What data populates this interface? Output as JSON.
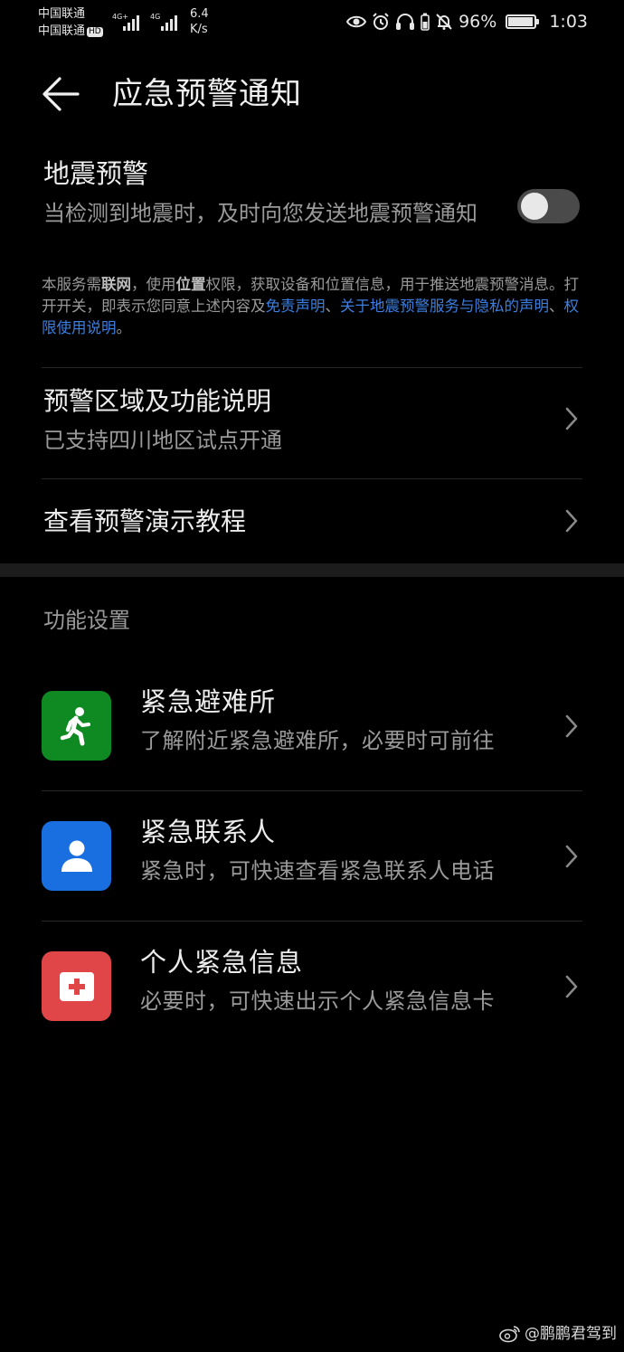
{
  "status_bar": {
    "carrier1": "中国联通",
    "carrier2": "中国联通",
    "hd_badge": "HD",
    "net1": "4G+",
    "net2": "4G",
    "speed_value": "6.4",
    "speed_unit": "K/s",
    "battery_percent": "96%",
    "battery_level": 0.96,
    "time": "1:03",
    "icons": [
      "eye-icon",
      "alarm-icon",
      "headset-icon",
      "mute-bell-icon",
      "battery-icon"
    ]
  },
  "header": {
    "back_icon": "arrow-left-icon",
    "title": "应急预警通知"
  },
  "earthquake": {
    "title": "地震预警",
    "description": "当检测到地震时，及时向您发送地震预警通知",
    "toggle_on": false,
    "notice": {
      "p1": "本服务需",
      "b1": "联网",
      "p2": "，使用",
      "b2": "位置",
      "p3": "权限，获取设备和位置信息，用于推送地震预警消息。打开开关，即表示您同意上述内容及",
      "link1": "免责声明",
      "sep1": "、",
      "link2": "关于地震预警服务与隐私的声明",
      "sep2": "、",
      "link3": "权限使用说明",
      "end": "。"
    }
  },
  "rows": {
    "region": {
      "title": "预警区域及功能说明",
      "subtitle": "已支持四川地区试点开通"
    },
    "tutorial": {
      "title": "查看预警演示教程"
    }
  },
  "section": {
    "label": "功能设置"
  },
  "features": [
    {
      "title": "紧急避难所",
      "subtitle": "了解附近紧急避难所，必要时可前往",
      "icon": "running-person-icon",
      "color": "#0f8a23"
    },
    {
      "title": "紧急联系人",
      "subtitle": "紧急时，可快速查看紧急联系人电话",
      "icon": "contact-person-icon",
      "color": "#1a6fe0"
    },
    {
      "title": "个人紧急信息",
      "subtitle": "必要时，可快速出示个人紧急信息卡",
      "icon": "medical-cross-icon",
      "color": "#e04648"
    }
  ],
  "watermark": {
    "text": "@鹏鹏君驾到",
    "icon": "weibo-icon"
  }
}
